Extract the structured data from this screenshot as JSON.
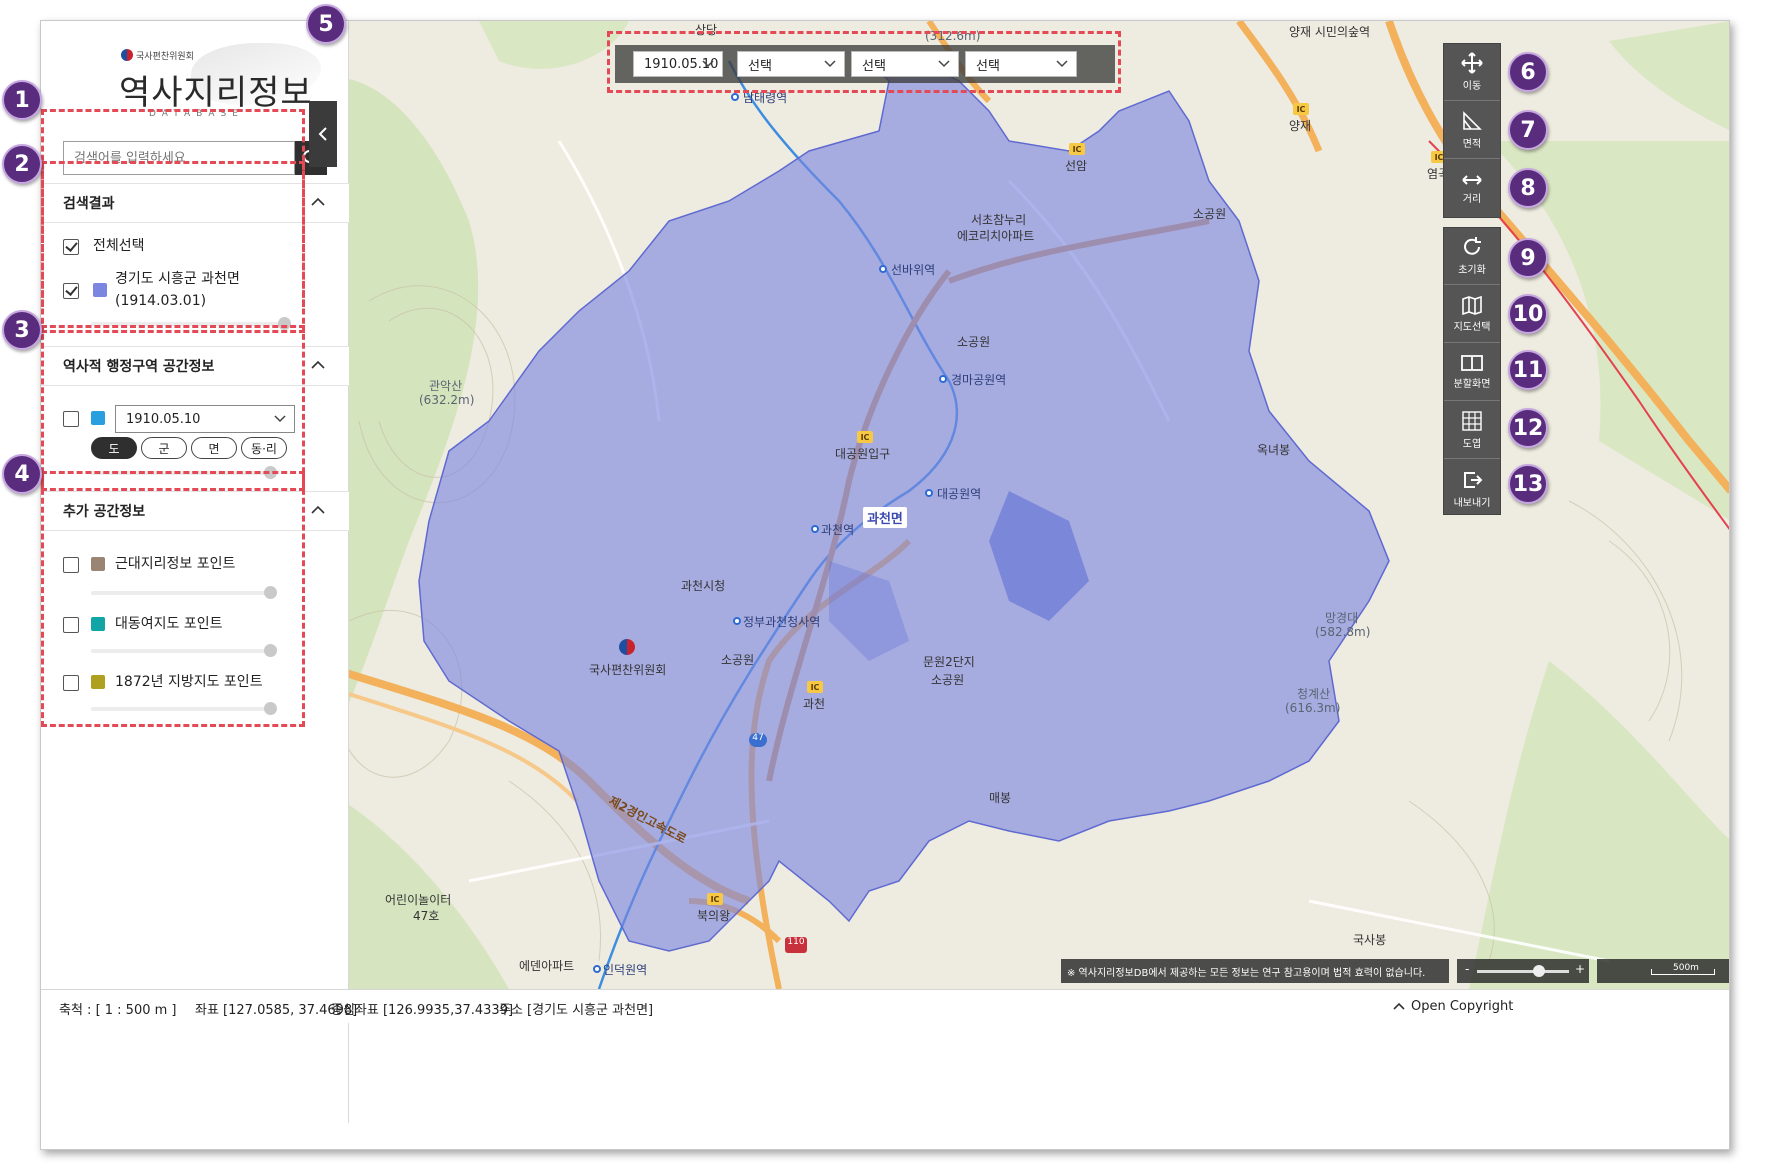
{
  "logo": {
    "org": "국사편찬위원회",
    "title": "역사지리정보",
    "subtitle": "DATABASE"
  },
  "search": {
    "placeholder": "검색어를 입력하세요"
  },
  "results": {
    "header": "검색결과",
    "select_all": "전체선택",
    "items": [
      {
        "name": "경기도 시흥군 과천면",
        "date": "(1914.03.01)",
        "color": "#7b86e0"
      }
    ]
  },
  "admin": {
    "header": "역사적 행정구역 공간정보",
    "date_value": "1910.05.10",
    "color": "#2a9fe0",
    "levels": [
      "도",
      "군",
      "면",
      "동·리"
    ],
    "active_level": "도"
  },
  "extra": {
    "header": "추가 공간정보",
    "items": [
      {
        "label": "근대지리정보 포인트",
        "color": "#9a8575"
      },
      {
        "label": "대동여지도 포인트",
        "color": "#12a5a5"
      },
      {
        "label": "1872년 지방지도 포인트",
        "color": "#b0a020"
      }
    ]
  },
  "datebar": {
    "date": "1910.05.10",
    "sel1": "선택",
    "sel2": "선택",
    "sel3": "선택"
  },
  "tools": {
    "move": "이동",
    "area": "면적",
    "distance": "거리",
    "reset": "초기화",
    "map_select": "지도선택",
    "split": "분할화면",
    "sheet": "도엽",
    "export": "내보내기"
  },
  "badges": [
    "1",
    "2",
    "3",
    "4",
    "5",
    "6",
    "7",
    "8",
    "9",
    "10",
    "11",
    "12",
    "13"
  ],
  "map": {
    "region_label": "과천면",
    "labels": {
      "namtaeryeong": "남태령역",
      "seonbawi": "선바위역",
      "gyeongmapark": "경마공원역",
      "daegongwonipgu": "대공원입구",
      "daegongwonyeok": "대공원역",
      "gwacheonyeok": "과천역",
      "gwacheonsicheong": "과천시청",
      "jeongbu": "정부과천청사역",
      "guksa": "국사편찬위원회",
      "sogongwon1": "소공원",
      "sogongwon2": "소공원",
      "sogongwon3": "소공원",
      "munwon": "문원2단지",
      "munwon2": "소공원",
      "gwacheon_ic": "과천",
      "bukuiwang": "북의왕",
      "indeogwon": "인덕원역",
      "eden": "에덴아파트",
      "children": "어린이놀이터",
      "children2": "47호",
      "seocho": "서초참누리",
      "seocho2": "에코리치아파트",
      "yangjae": "양재",
      "yeomgok": "염곡",
      "seonam": "선암",
      "sangdang": "상당",
      "yangjaecitizen": "양재 시민의숲역",
      "gwanaksan": "관악산",
      "gwanaksan_h": "(632.2m)",
      "mangyeongdae": "망경대",
      "mangyeongdae_h": "(582.8m)",
      "cheonggyesan": "청계산",
      "cheonggyesan_h": "(616.3m)",
      "top_h": "(312.6m)",
      "okneobong": "옥녀봉",
      "maebong": "매봉",
      "guksabong": "국사봉",
      "highway": "제2경인고속도로",
      "route47": "47",
      "route110": "110"
    }
  },
  "notice": "※ 역사지리정보DB에서 제공하는 모든 정보는 연구 참고용이며 법적 효력이 없습니다.",
  "scalebar": "500m",
  "status": {
    "scale": "축척 : [ 1 : 500 m ]",
    "coord": "좌표 [127.0585, 37.4698]",
    "center": "중심좌표 [126.9935,37.4339]",
    "address": "주소 [경기도 시흥군 과천면]",
    "copyright": "Open Copyright"
  },
  "colors": {
    "accent_dash": "#e34a55",
    "badge": "#5a2c7e",
    "region_fill": "#7b86e0"
  }
}
